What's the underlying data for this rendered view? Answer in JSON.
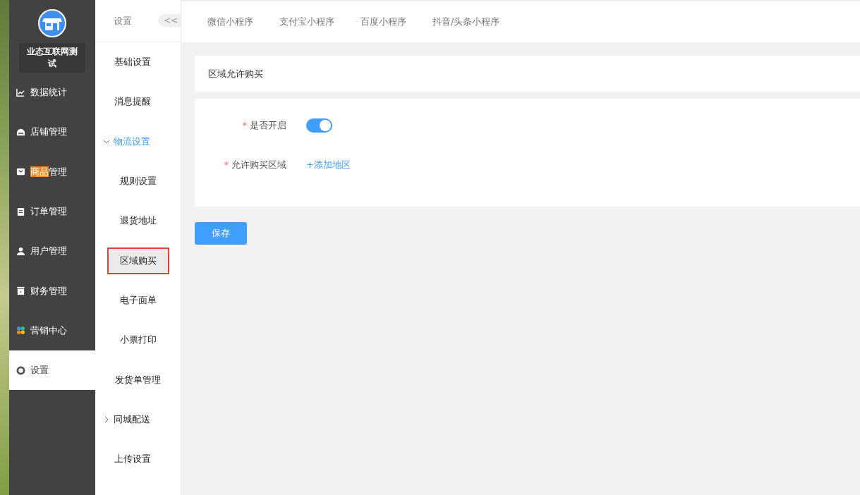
{
  "store": {
    "name": "业态互联网测试"
  },
  "sidebar": {
    "items": [
      {
        "kind": "chart",
        "label_parts": [
          {
            "text": "数据统计",
            "highlighted": false
          }
        ],
        "selected": false
      },
      {
        "kind": "shop",
        "label_parts": [
          {
            "text": "店铺管理",
            "highlighted": false
          }
        ],
        "selected": false
      },
      {
        "kind": "goods",
        "label_parts": [
          {
            "text": "商品",
            "highlighted": true
          },
          {
            "text": "管理",
            "highlighted": false
          }
        ],
        "selected": false
      },
      {
        "kind": "order",
        "label_parts": [
          {
            "text": "订单管理",
            "highlighted": false
          }
        ],
        "selected": false
      },
      {
        "kind": "user",
        "label_parts": [
          {
            "text": "用户管理",
            "highlighted": false
          }
        ],
        "selected": false
      },
      {
        "kind": "finance",
        "label_parts": [
          {
            "text": "财务管理",
            "highlighted": false
          }
        ],
        "selected": false
      },
      {
        "kind": "marketing",
        "label_parts": [
          {
            "text": "营销中心",
            "highlighted": false
          }
        ],
        "selected": false
      },
      {
        "kind": "settings",
        "label_parts": [
          {
            "text": "设置",
            "highlighted": false
          }
        ],
        "selected": true
      }
    ]
  },
  "submenu": {
    "title": "设置",
    "collapse_button": "<<",
    "items": [
      {
        "label": "基础设置",
        "selected": false,
        "outlined": false
      },
      {
        "label": "消息提醒",
        "selected": false,
        "outlined": false
      },
      {
        "kind": "group",
        "label": "物流设置",
        "expanded": true,
        "children": [
          {
            "label": "规则设置",
            "selected": false,
            "outlined": false
          },
          {
            "label": "退货地址",
            "selected": false,
            "outlined": false
          },
          {
            "label": "区域购买",
            "selected": true,
            "outlined": true
          },
          {
            "label": "电子面单",
            "selected": false,
            "outlined": false
          },
          {
            "label": "小票打印",
            "selected": false,
            "outlined": false
          },
          {
            "label": "发货单管理",
            "selected": false,
            "outlined": false
          }
        ]
      },
      {
        "kind": "group",
        "label": "同城配送",
        "expanded": false
      },
      {
        "label": "上传设置",
        "selected": false,
        "outlined": false
      }
    ]
  },
  "tabs": [
    {
      "label": "微信小程序",
      "selected": false
    },
    {
      "label": "支付宝小程序",
      "selected": false
    },
    {
      "label": "百度小程序",
      "selected": false
    },
    {
      "label": "抖音/头条小程序",
      "selected": false
    }
  ],
  "card": {
    "title": "区域允许购买"
  },
  "form": {
    "fields": [
      {
        "kind": "switch",
        "required_mark": "*",
        "label": "是否开启",
        "on": true
      },
      {
        "kind": "link",
        "required_mark": "*",
        "label": "允许购买区域",
        "link": "+添加地区"
      }
    ]
  },
  "save_button": "保存"
}
